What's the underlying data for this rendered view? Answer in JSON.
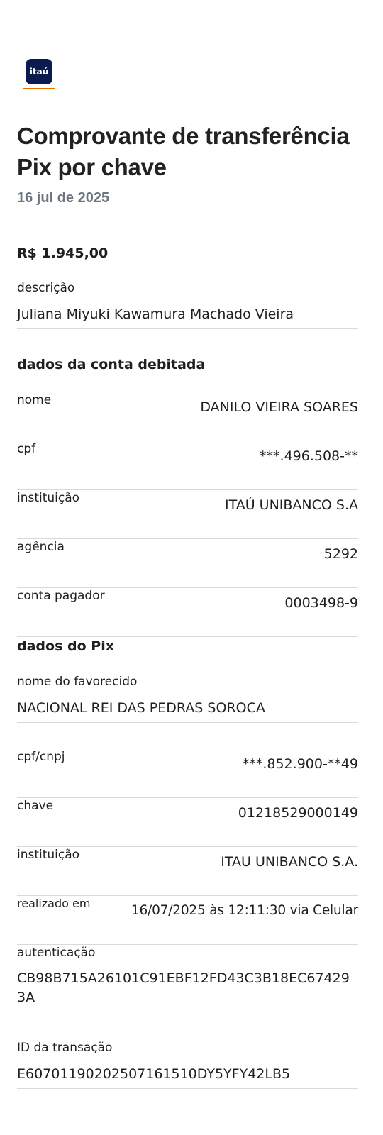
{
  "logo": {
    "text": "itaú",
    "brand_color": "#0b1b4d",
    "accent_color": "#ec7000"
  },
  "header": {
    "title": "Comprovante de transferência Pix por chave",
    "date": "16 jul de 2025"
  },
  "amount": "R$ 1.945,00",
  "descricao": {
    "label": "descrição",
    "value": "Juliana Miyuki Kawamura Machado Vieira"
  },
  "conta_debitada": {
    "title": "dados da conta debitada",
    "nome": {
      "label": "nome",
      "value": "DANILO VIEIRA SOARES"
    },
    "cpf": {
      "label": "cpf",
      "value": "***.496.508-**"
    },
    "instituicao": {
      "label": "instituição",
      "value": "ITAÚ UNIBANCO S.A"
    },
    "agencia": {
      "label": "agência",
      "value": "5292"
    },
    "conta": {
      "label": "conta pagador",
      "value": "0003498-9"
    }
  },
  "pix": {
    "title": "dados do Pix",
    "favorecido": {
      "label": "nome do favorecido",
      "value": "NACIONAL REI DAS PEDRAS SOROCA"
    },
    "cpf_cnpj": {
      "label": "cpf/cnpj",
      "value": "***.852.900-**49"
    },
    "chave": {
      "label": "chave",
      "value": "01218529000149"
    },
    "instituicao": {
      "label": "instituição",
      "value": "ITAU UNIBANCO S.A."
    },
    "realizado": {
      "label": "realizado em",
      "value": "16/07/2025 às 12:11:30 via Celular"
    },
    "autenticacao": {
      "label": "autenticação",
      "value": "CB98B715A26101C91EBF12FD43C3B18EC674293A"
    },
    "id_transacao": {
      "label": "ID da transação",
      "value": "E60701190202507161510DY5YFY42LB5"
    }
  }
}
